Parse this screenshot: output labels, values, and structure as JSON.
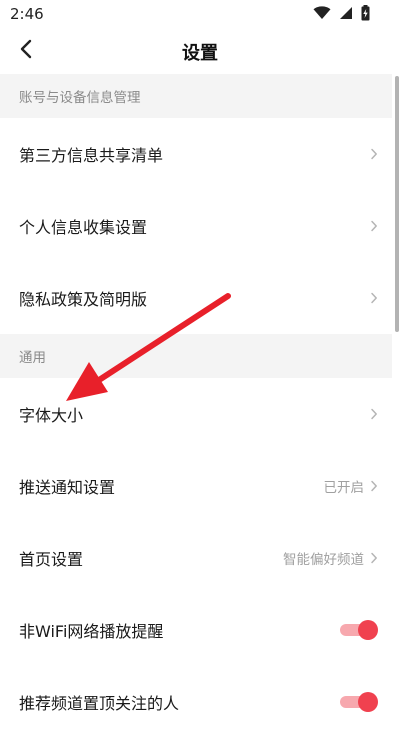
{
  "status_bar": {
    "time": "2:46",
    "icons": [
      "wifi-icon",
      "cellular-signal-icon",
      "battery-charging-icon"
    ]
  },
  "nav": {
    "title": "设置",
    "back_icon": "back-arrow-icon"
  },
  "sections": [
    {
      "header": "账号与设备信息管理",
      "items": [
        {
          "label": "第三方信息共享清单",
          "value": "",
          "control": "chevron"
        },
        {
          "label": "个人信息收集设置",
          "value": "",
          "control": "chevron"
        },
        {
          "label": "隐私政策及简明版",
          "value": "",
          "control": "chevron"
        }
      ]
    },
    {
      "header": "通用",
      "items": [
        {
          "label": "字体大小",
          "value": "",
          "control": "chevron"
        },
        {
          "label": "推送通知设置",
          "value": "已开启",
          "control": "chevron"
        },
        {
          "label": "首页设置",
          "value": "智能偏好频道",
          "control": "chevron"
        },
        {
          "label": "非WiFi网络播放提醒",
          "value": "",
          "control": "toggle",
          "on": true
        },
        {
          "label": "推荐频道置顶关注的人",
          "value": "",
          "control": "toggle",
          "on": true
        }
      ]
    }
  ],
  "colors": {
    "accent": "#f0414f",
    "toggle_track": "#f7a8ae",
    "section_bg": "#f4f4f4",
    "annotation_arrow": "#e8202a"
  }
}
